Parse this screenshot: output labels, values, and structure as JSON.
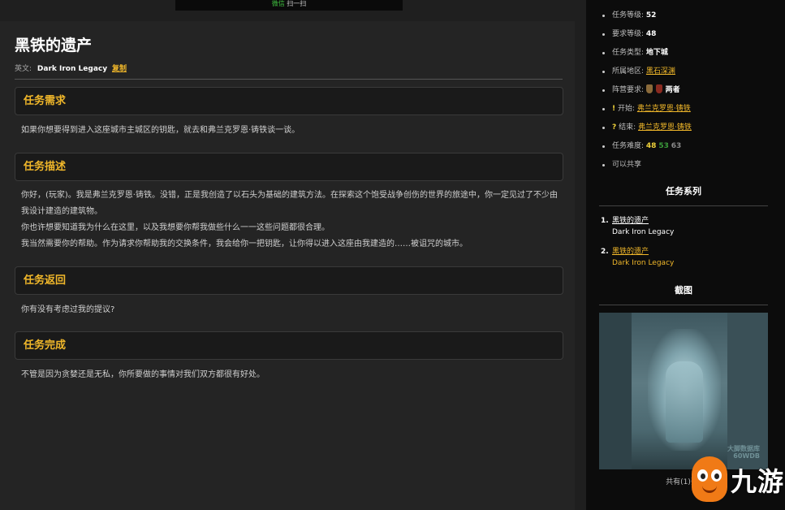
{
  "banner": {
    "wechat": "微信",
    "scan": "扫一扫"
  },
  "quest": {
    "title": "黑铁的遗产",
    "en_label": "英文:",
    "en_name": "Dark Iron Legacy",
    "copy_label": "复制"
  },
  "sections": [
    {
      "heading": "任务需求",
      "paragraphs": [
        "如果你想要得到进入这座城市主城区的钥匙，就去和弗兰克罗恩·铸铁谈一谈。"
      ]
    },
    {
      "heading": "任务描述",
      "paragraphs": [
        "你好，(玩家)。我是弗兰克罗恩·铸铁。没错，正是我创造了以石头为基础的建筑方法。在探索这个饱受战争创伤的世界的旅途中，你一定见过了不少由我设计建造的建筑物。",
        "你也许想要知道我为什么在这里，以及我想要你帮我做些什么一一这些问题都很合理。",
        "我当然需要你的帮助。作为请求你帮助我的交换条件，我会给你一把钥匙，让你得以进入这座由我建造的……被诅咒的城市。"
      ]
    },
    {
      "heading": "任务返回",
      "paragraphs": [
        "你有没有考虑过我的提议?"
      ]
    },
    {
      "heading": "任务完成",
      "paragraphs": [
        "不管是因为贪婪还是无私，你所要做的事情对我们双方都很有好处。"
      ]
    }
  ],
  "sidebar": {
    "info": {
      "quest_level_label": "任务等级:",
      "quest_level": "52",
      "req_level_label": "要求等级:",
      "req_level": "48",
      "type_label": "任务类型:",
      "type": "地下城",
      "zone_label": "所属地区:",
      "zone": "黑石深渊",
      "faction_label": "阵营要求:",
      "faction": "两者",
      "start_mark": "!",
      "start_label": "开始:",
      "start_npc": "弗兰克罗恩·铸铁",
      "end_mark": "?",
      "end_label": "结束:",
      "end_npc": "弗兰克罗恩·铸铁",
      "difficulty_label": "任务难度:",
      "difficulty": [
        "48",
        "53",
        "63"
      ],
      "shareable": "可以共享"
    },
    "series_heading": "任务系列",
    "series": [
      {
        "num": "1.",
        "zh": "黑铁的遗产",
        "en": "Dark Iron Legacy"
      },
      {
        "num": "2.",
        "zh": "黑铁的遗产",
        "en": "Dark Iron Legacy"
      }
    ],
    "screenshot_heading": "截图",
    "screenshot_watermark": [
      "大脚数据库",
      "60WDB"
    ],
    "screenshot_caption": "共有(1)张"
  },
  "logo": {
    "brand": "九游"
  },
  "colors": {
    "accent": "#f0b72a",
    "bg": "#242424",
    "sidebar_bg": "#0c0c0c",
    "mascot": "#f07a16"
  }
}
